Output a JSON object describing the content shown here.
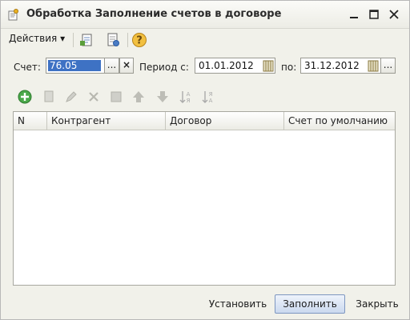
{
  "window": {
    "title": "Обработка  Заполнение счетов в договоре",
    "controls": [
      "minimize",
      "maximize",
      "close"
    ]
  },
  "toolbar": {
    "actions_label": "Действия",
    "icons": [
      "fill-document-icon",
      "settings-document-icon",
      "help-icon"
    ]
  },
  "form": {
    "account_label": "Счет:",
    "account_value": "76.05",
    "select_button": "...",
    "clear_button": "×",
    "period_from_label": "Период с:",
    "period_from_value": "01.01.2012",
    "period_to_label": "по:",
    "period_to_value": "31.12.2012",
    "period_select_button": "..."
  },
  "table_toolbar": {
    "icons": [
      "add-icon",
      "copy-icon",
      "edit-icon",
      "delete-icon",
      "stop-icon",
      "move-up-icon",
      "move-down-icon",
      "sort-asc-icon",
      "sort-desc-icon"
    ]
  },
  "table": {
    "columns": [
      "N",
      "Контрагент",
      "Договор",
      "Счет по умолчанию"
    ],
    "rows": []
  },
  "buttons": {
    "set": "Установить",
    "fill": "Заполнить",
    "close": "Закрыть"
  },
  "colors": {
    "selection": "#3e72c4",
    "window_bg": "#f1f1ea",
    "add_icon": "#4aa84a",
    "help_icon": "#e0a020"
  }
}
